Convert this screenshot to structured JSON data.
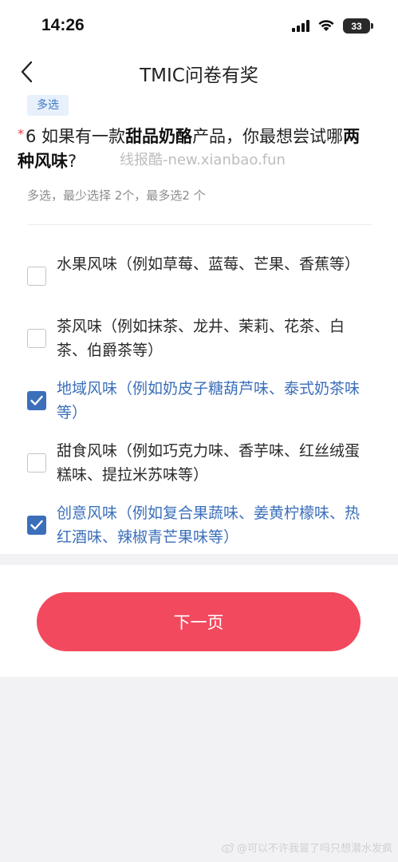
{
  "status_bar": {
    "time": "14:26",
    "battery": "33"
  },
  "nav": {
    "title": "TMIC问卷有奖"
  },
  "question": {
    "type_tag": "多选",
    "required_mark": "*",
    "number": "6",
    "text_part1": " 如果有一款",
    "bold1": "甜品奶酪",
    "text_part2": "产品，你最想尝试哪",
    "bold2": "两种风味",
    "text_part3": "?",
    "hint": "多选，最少选择 2个，最多选2 个"
  },
  "watermark": "线报酷-new.xianbao.fun",
  "options": [
    {
      "label": "水果风味（例如草莓、蓝莓、芒果、香蕉等）",
      "checked": false
    },
    {
      "label": "茶风味（例如抹茶、龙井、茉莉、花茶、白茶、伯爵茶等）",
      "checked": false
    },
    {
      "label": "地域风味（例如奶皮子糖葫芦味、泰式奶茶味等）",
      "checked": true
    },
    {
      "label": "甜食风味（例如巧克力味、香芋味、红丝绒蛋糕味、提拉米苏味等）",
      "checked": false
    },
    {
      "label": "创意风味（例如复合果蔬味、姜黄柠檬味、热红酒味、辣椒青芒果味等）",
      "checked": true
    }
  ],
  "footer": {
    "next_label": "下一页"
  },
  "weibo_watermark": "@可以不许我冒了吗只想潜水发疯",
  "colors": {
    "accent": "#3b6fba",
    "button": "#f2495e",
    "required": "#e23b4b"
  }
}
